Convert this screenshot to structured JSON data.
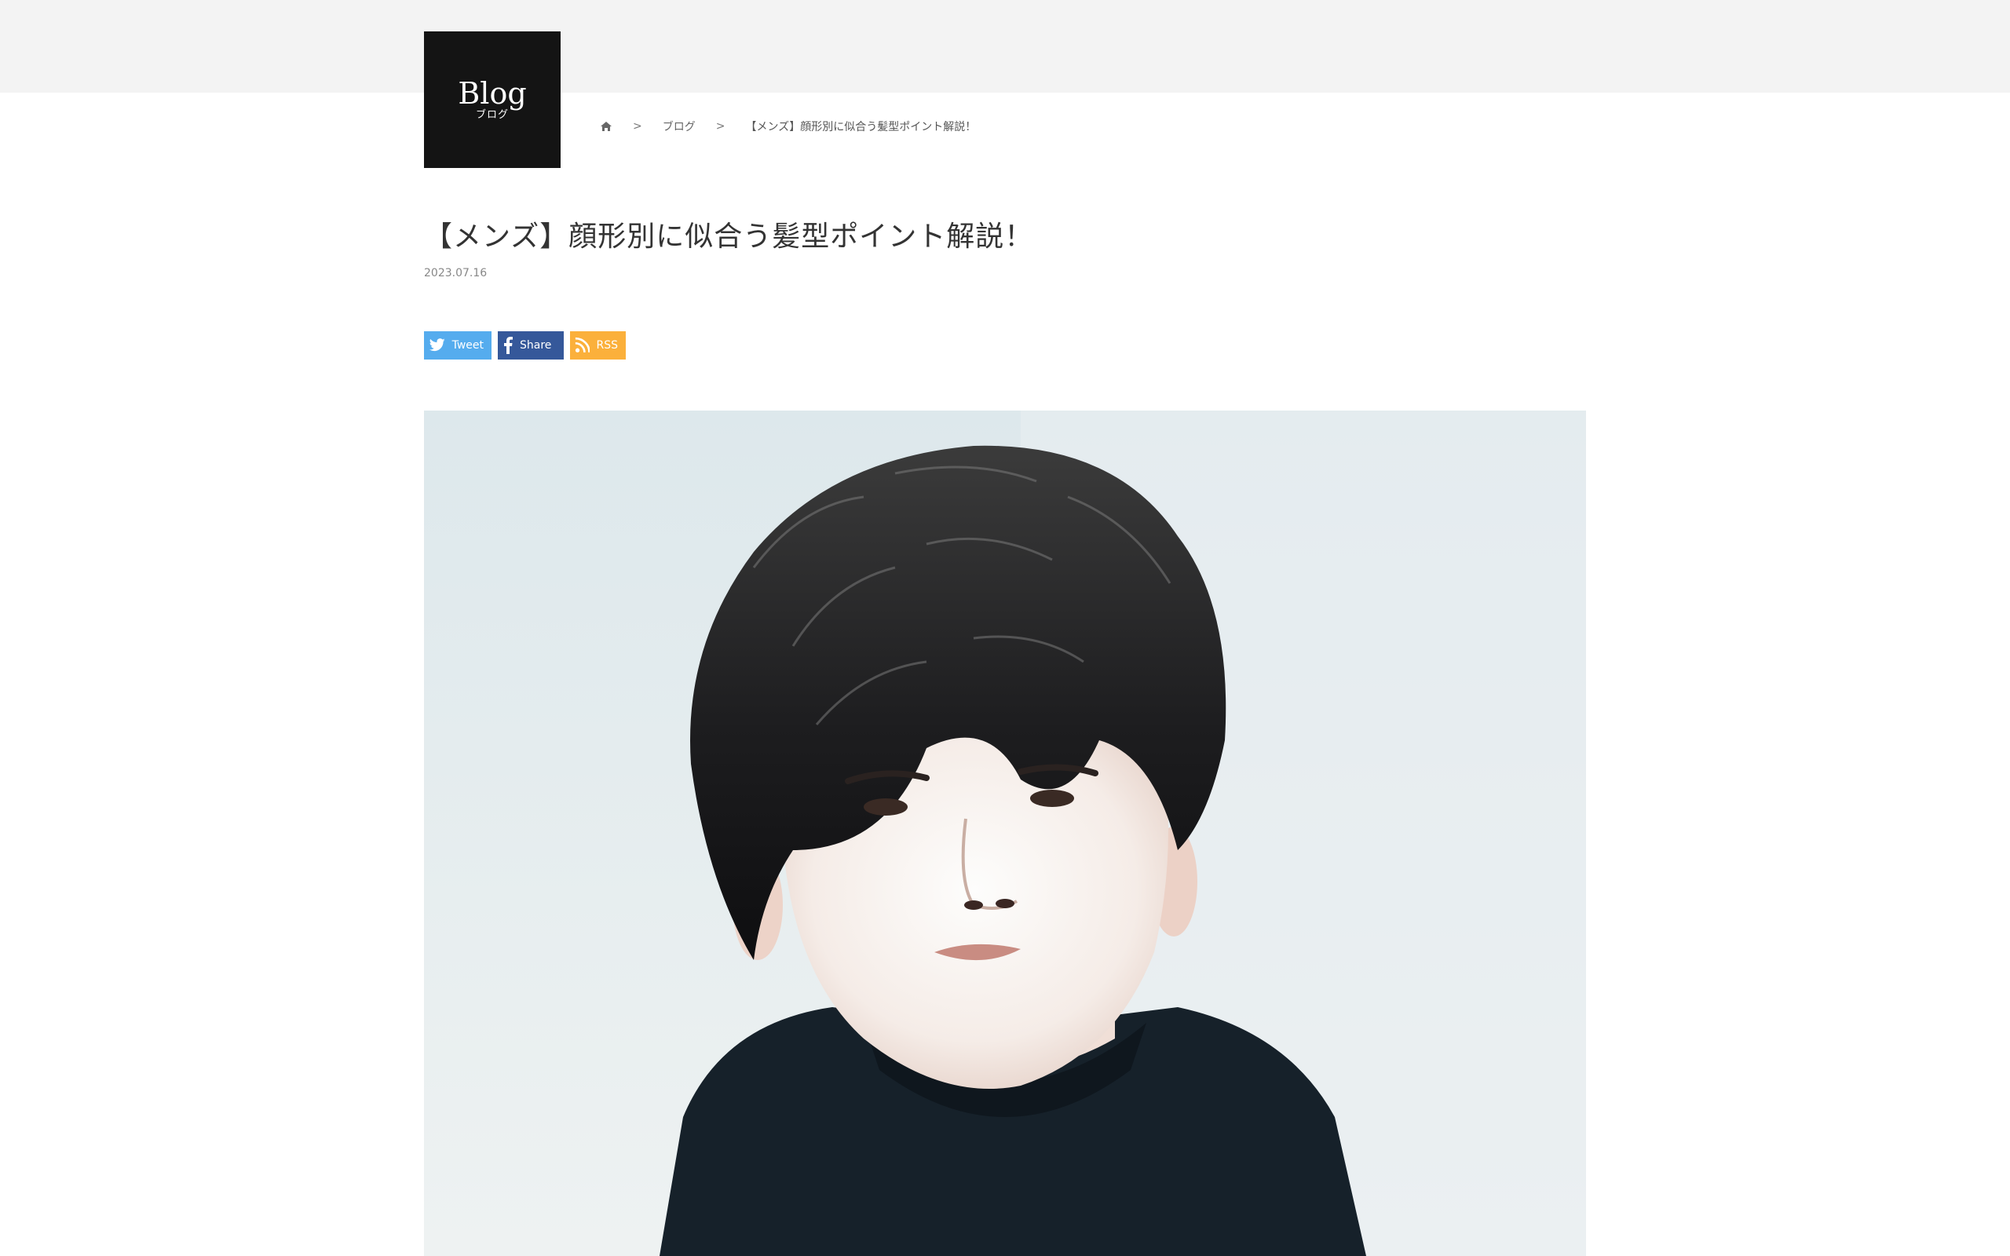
{
  "header": {
    "logo_title": "Blog",
    "logo_subtitle": "ブログ"
  },
  "breadcrumb": {
    "home_icon": "home-icon",
    "separator": ">",
    "items": [
      "ブログ",
      "【メンズ】顔形別に似合う髪型ポイント解説！"
    ]
  },
  "post": {
    "title": "【メンズ】顔形別に似合う髪型ポイント解説！",
    "date": "2023.07.16"
  },
  "share": {
    "tweet": {
      "label": "Tweet",
      "icon": "twitter-icon",
      "color": "#55acee"
    },
    "facebook": {
      "label": "Share",
      "icon": "facebook-icon",
      "color": "#35589a"
    },
    "rss": {
      "label": "RSS",
      "icon": "rss-icon",
      "color": "#fbb03b"
    }
  },
  "hero_image": {
    "description_icon": "portrait-photo"
  },
  "colors": {
    "top_band": "#f3f3f3",
    "logo_bg": "#141414"
  }
}
